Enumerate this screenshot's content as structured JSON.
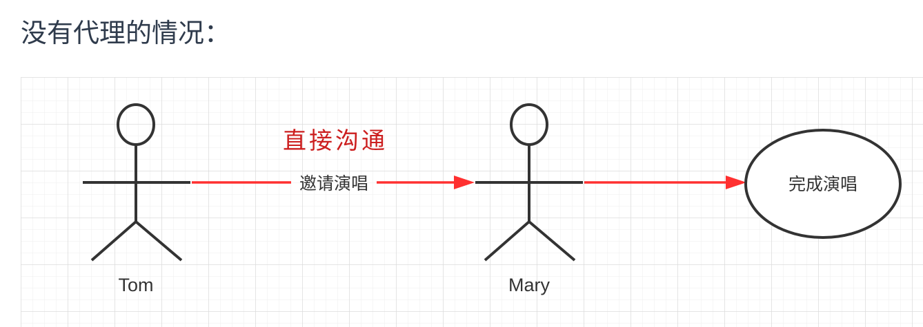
{
  "heading": "没有代理的情况：",
  "diagram": {
    "actors": [
      {
        "id": "tom",
        "name": "Tom"
      },
      {
        "id": "mary",
        "name": "Mary"
      }
    ],
    "annotation": "直接沟通",
    "message_label": "邀请演唱",
    "result_label": "完成演唱",
    "colors": {
      "arrow": "#ff3030",
      "stroke": "#333333",
      "grid": "#e6e6e6",
      "annotation": "#cc1f1f"
    }
  }
}
